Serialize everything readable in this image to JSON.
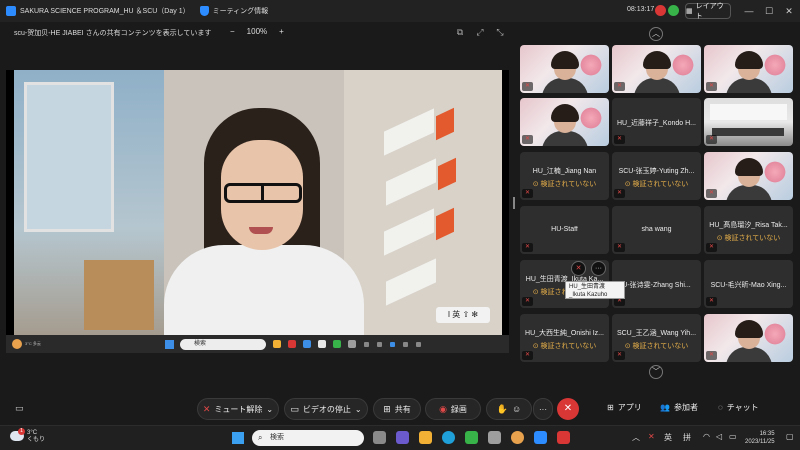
{
  "window": {
    "title": "SAKURA SCIENCE PROGRAM_HU ＆SCU（Day 1）",
    "meeting_info_label": "ミーティング情報",
    "clock": "08:13:17",
    "layout_label": "レイアウト"
  },
  "share_header": {
    "label": "scu-贺加贝-HE JIABEI さんの共有コンテンツを表示しています",
    "zoom_minus": "−",
    "zoom_level": "100%",
    "zoom_plus": "+"
  },
  "shared_screen": {
    "caption_chip": "I 英 ⇧ ✻",
    "inner_search": "検索",
    "weather_text": "3°C 多云"
  },
  "gallery": {
    "unverified_text": "⊙ 検証されていない",
    "tiles": [
      {
        "name": "",
        "video": true
      },
      {
        "name": "",
        "video": true
      },
      {
        "name": "",
        "video": true
      },
      {
        "name": "",
        "video": true
      },
      {
        "name": "HU_近藤祥子_Kondo H...",
        "video": false,
        "unverified": false
      },
      {
        "name": "",
        "video": "room"
      },
      {
        "name": "HU_江楠_Jiang Nan",
        "video": false,
        "unverified": true
      },
      {
        "name": "SCU-张玉婷-Yuting Zh...",
        "video": false,
        "unverified": true
      },
      {
        "name": "",
        "video": true
      },
      {
        "name": "HU-Staff",
        "video": false,
        "unverified": false
      },
      {
        "name": "sha wang",
        "video": false,
        "unverified": false
      },
      {
        "name": "HU_髙島瑠汐_Risa Tak...",
        "video": false,
        "unverified": true
      },
      {
        "name": "HU_生田青渡_Ikuta Ka...",
        "video": false,
        "unverified": true
      },
      {
        "name": "U-张诗雯-Zhang Shi...",
        "video": false,
        "unverified": false
      },
      {
        "name": "SCU-毛兴昕-Mao Xing...",
        "video": false,
        "unverified": false
      },
      {
        "name": "HU_大西生純_Onishi Iz...",
        "video": false,
        "unverified": true
      },
      {
        "name": "SCU_王乙涵_Wang Yih...",
        "video": false,
        "unverified": true
      },
      {
        "name": "",
        "video": true
      }
    ],
    "tooltip": "HU_生田青渡_Ikuta Kazuho"
  },
  "toolbar": {
    "unmute": "ミュート解除",
    "stop_video": "ビデオの停止",
    "share": "共有",
    "record": "録画",
    "apps": "アプリ",
    "participants": "参加者",
    "chat": "チャット"
  },
  "taskbar": {
    "weather_temp": "3°C",
    "weather_desc": "くもり",
    "badge": "1",
    "search_placeholder": "検索",
    "ime1": "英",
    "ime2": "拼",
    "time": "16:35",
    "date": "2023/11/25"
  }
}
